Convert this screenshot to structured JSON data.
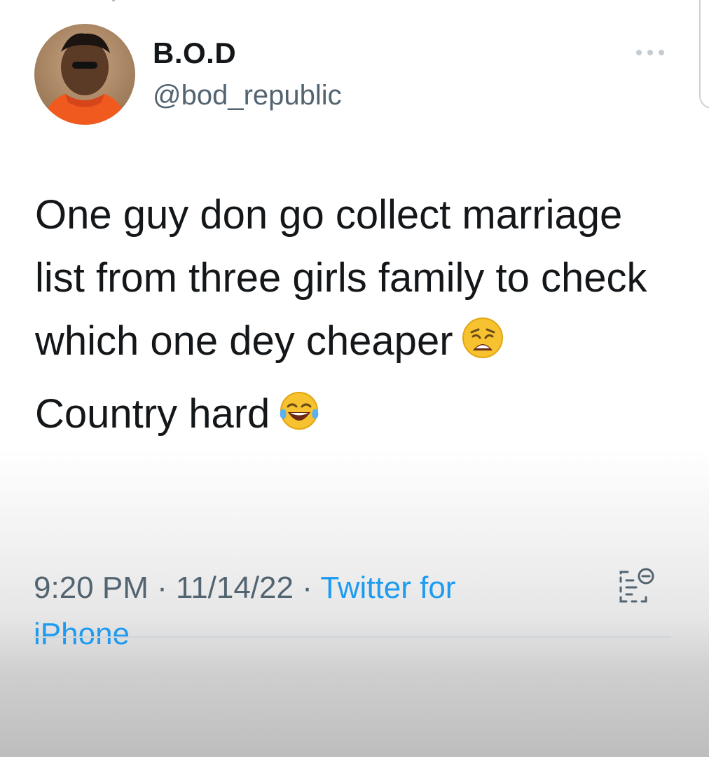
{
  "tweet": {
    "author": {
      "display_name": "B.O.D",
      "handle": "@bod_republic"
    },
    "more_menu_icon": "ellipsis-icon",
    "text_paragraphs": [
      "One guy don go collect marriage list from three girls family to check which one dey cheaper",
      "Country hard"
    ],
    "emojis": [
      "weary-face-icon",
      "tears-of-joy-icon"
    ],
    "time": "9:20 PM",
    "date": "11/14/22",
    "separator": " · ",
    "source_prefix": "Twitter for",
    "source_suffix": "iPhone",
    "analytics_icon": "analytics-icon",
    "colors": {
      "text": "#14171a",
      "secondary": "#536471",
      "link": "#1d9bf0"
    }
  }
}
